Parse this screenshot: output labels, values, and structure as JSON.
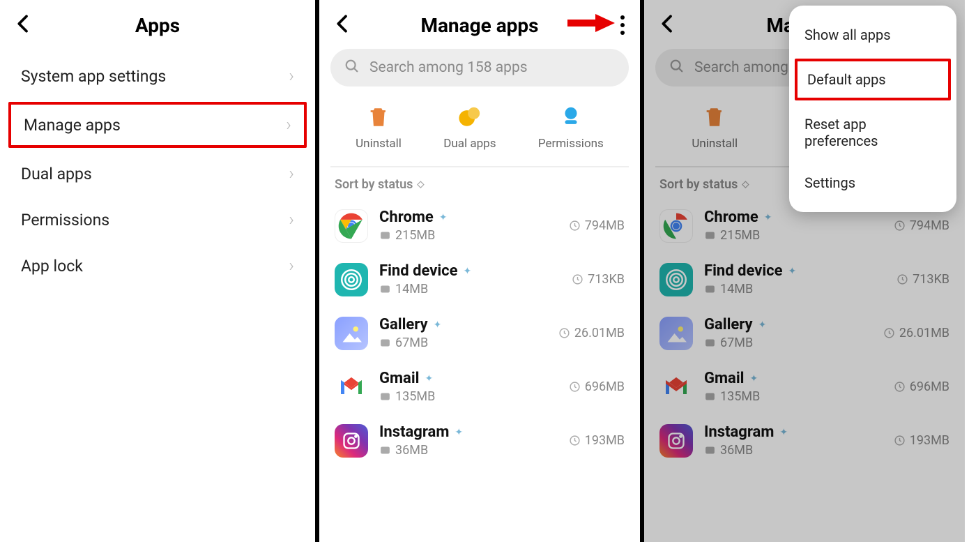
{
  "panel1": {
    "title": "Apps",
    "items": [
      {
        "label": "System app settings"
      },
      {
        "label": "Manage apps",
        "highlight": true
      },
      {
        "label": "Dual apps"
      },
      {
        "label": "Permissions"
      },
      {
        "label": "App lock"
      }
    ]
  },
  "panel2": {
    "title": "Manage apps",
    "search_placeholder": "Search among 158 apps",
    "actions": {
      "uninstall": "Uninstall",
      "dual": "Dual apps",
      "permissions": "Permissions"
    },
    "sort_label": "Sort by status",
    "apps": [
      {
        "name": "Chrome",
        "storage": "215MB",
        "time_size": "794MB"
      },
      {
        "name": "Find device",
        "storage": "14MB",
        "time_size": "713KB"
      },
      {
        "name": "Gallery",
        "storage": "67MB",
        "time_size": "26.01MB"
      },
      {
        "name": "Gmail",
        "storage": "135MB",
        "time_size": "696MB"
      },
      {
        "name": "Instagram",
        "storage": "36MB",
        "time_size": "193MB"
      }
    ]
  },
  "panel3": {
    "title": "Manage apps",
    "search_placeholder": "Search among",
    "actions": {
      "uninstall": "Uninstall",
      "dual_initial": "D"
    },
    "sort_label": "Sort by status",
    "apps": [
      {
        "name": "Chrome",
        "storage": "215MB",
        "time_size": "794MB"
      },
      {
        "name": "Find device",
        "storage": "14MB",
        "time_size": "713KB"
      },
      {
        "name": "Gallery",
        "storage": "67MB",
        "time_size": "26.01MB"
      },
      {
        "name": "Gmail",
        "storage": "135MB",
        "time_size": "696MB"
      },
      {
        "name": "Instagram",
        "storage": "36MB",
        "time_size": "193MB"
      }
    ],
    "menu": [
      {
        "label": "Show all apps"
      },
      {
        "label": "Default apps",
        "highlight": true
      },
      {
        "label": "Reset app preferences"
      },
      {
        "label": "Settings"
      }
    ]
  }
}
